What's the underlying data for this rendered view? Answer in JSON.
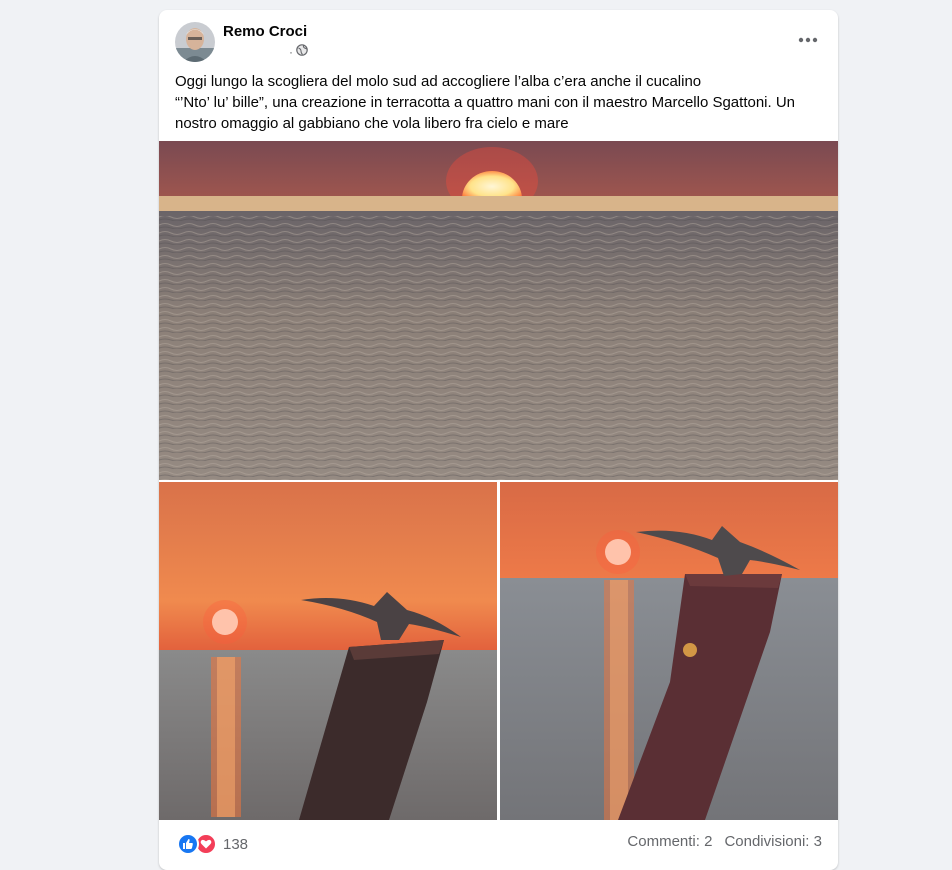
{
  "post": {
    "author": "Remo Croci",
    "meta_separator": "·",
    "privacy_icon": "globe-icon",
    "more_icon": "more-horizontal-icon",
    "text_lines": [
      "Oggi lungo la scogliera del molo sud ad accogliere l’alba c’era anche il cucalino",
      "“’Nto’ lu’ bille”, una creazione in terracotta a quattro mani con il maestro Marcello Sgattoni. Un",
      "nostro omaggio al gabbiano che vola libero fra cielo e mare"
    ]
  },
  "photos": [
    {
      "subject": "sunrise over the sea",
      "icon": "photo-sunrise"
    },
    {
      "subject": "terracotta seagull on wooden post at sunrise",
      "icon": "photo-seagull-1"
    },
    {
      "subject": "terracotta seagull on wooden post at sunrise, close",
      "icon": "photo-seagull-2"
    }
  ],
  "footer": {
    "reaction_icons": [
      "like-icon",
      "love-icon"
    ],
    "reaction_count": "138",
    "comments": "Commenti: 2",
    "shares": "Condivisioni: 3"
  },
  "colors": {
    "like": "#1877f2",
    "love": "#f33e58",
    "secondary_text": "#65676b",
    "background": "#f0f2f5"
  }
}
